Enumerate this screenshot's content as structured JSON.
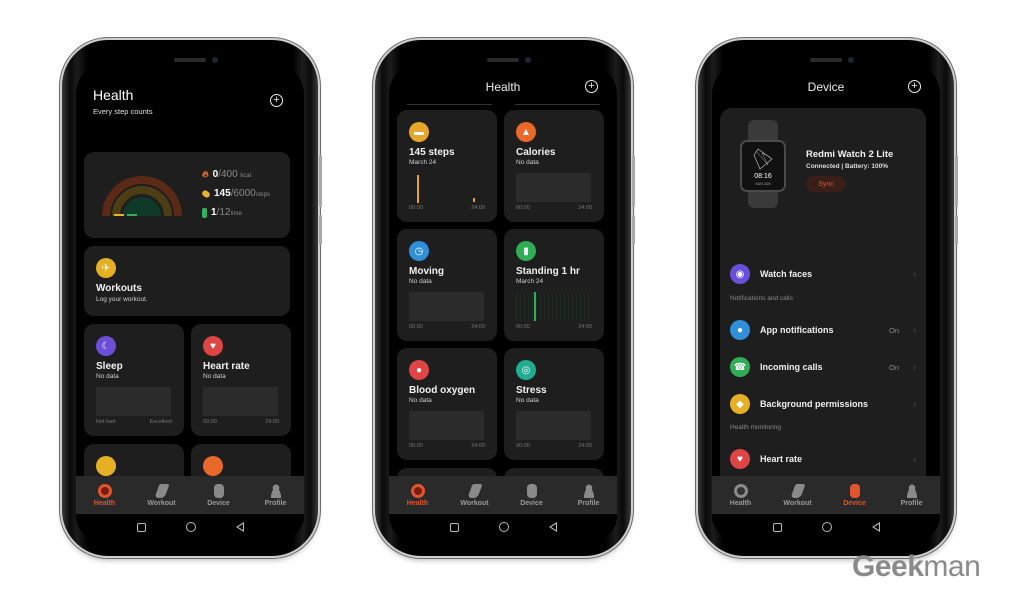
{
  "watermark": {
    "bold": "Geek",
    "light": "man"
  },
  "nav": {
    "tabs": [
      {
        "label": "Health",
        "icon": "health-ring-icon"
      },
      {
        "label": "Workout",
        "icon": "shoe-icon"
      },
      {
        "label": "Device",
        "icon": "watch-icon"
      },
      {
        "label": "Profile",
        "icon": "person-icon"
      }
    ]
  },
  "phone1": {
    "title": "Health",
    "subtitle": "Every step counts",
    "active_tab": "Health",
    "summary": {
      "calories": {
        "value": "0",
        "goal": "/400",
        "unit": "kcal",
        "color": "#e8692a"
      },
      "steps": {
        "value": "145",
        "goal": "/6000",
        "unit": "steps",
        "color": "#e5b530"
      },
      "standing": {
        "value": "1",
        "goal": "/12",
        "unit": "time",
        "color": "#33b05a"
      }
    },
    "workouts": {
      "title": "Workouts",
      "subtitle": "Log your workout."
    },
    "sleep": {
      "title": "Sleep",
      "subtitle": "No data",
      "axis_left": "Not bad",
      "axis_right": "Excellent"
    },
    "heart_rate": {
      "title": "Heart rate",
      "subtitle": "No data",
      "axis_left": "00:00",
      "axis_right": "24:00"
    }
  },
  "phone2": {
    "title": "Health",
    "active_tab": "Health",
    "cards": [
      {
        "title": "145 steps",
        "subtitle": "March 24",
        "axis_left": "00:00",
        "axis_right": "24:00",
        "color": "#e5a62a",
        "icon": "steps-icon"
      },
      {
        "title": "Calories",
        "subtitle": "No data",
        "axis_left": "00:00",
        "axis_right": "24:00",
        "color": "#e8692a",
        "icon": "flame-icon"
      },
      {
        "title": "Moving",
        "subtitle": "No data",
        "axis_left": "00:00",
        "axis_right": "24:00",
        "color": "#2f8fd8",
        "icon": "clock-icon"
      },
      {
        "title": "Standing 1 hr",
        "subtitle": "March 24",
        "axis_left": "00:00",
        "axis_right": "24:00",
        "color": "#2fae55",
        "icon": "standing-person-icon"
      },
      {
        "title": "Blood oxygen",
        "subtitle": "No data",
        "axis_left": "00:00",
        "axis_right": "24:00",
        "color": "#e04545",
        "icon": "blood-oxygen-icon"
      },
      {
        "title": "Stress",
        "subtitle": "No data",
        "axis_left": "00:00",
        "axis_right": "24:00",
        "color": "#1fae92",
        "icon": "stress-icon"
      }
    ]
  },
  "phone3": {
    "title": "Device",
    "active_tab": "Device",
    "device": {
      "name": "Redmi Watch 2 Lite",
      "status": "Connected | Battery: 100%",
      "sync_label": "Sync",
      "watch_time": "08:16",
      "watch_date": "SUN 3/24"
    },
    "watch_faces": {
      "label": "Watch faces"
    },
    "section_notifications": "Notifications and calls",
    "app_notifications": {
      "label": "App notifications",
      "value": "On"
    },
    "incoming_calls": {
      "label": "Incoming calls",
      "value": "On"
    },
    "background_permissions": {
      "label": "Background permissions"
    },
    "section_health": "Health monitoring",
    "heart_rate": {
      "label": "Heart rate"
    }
  }
}
